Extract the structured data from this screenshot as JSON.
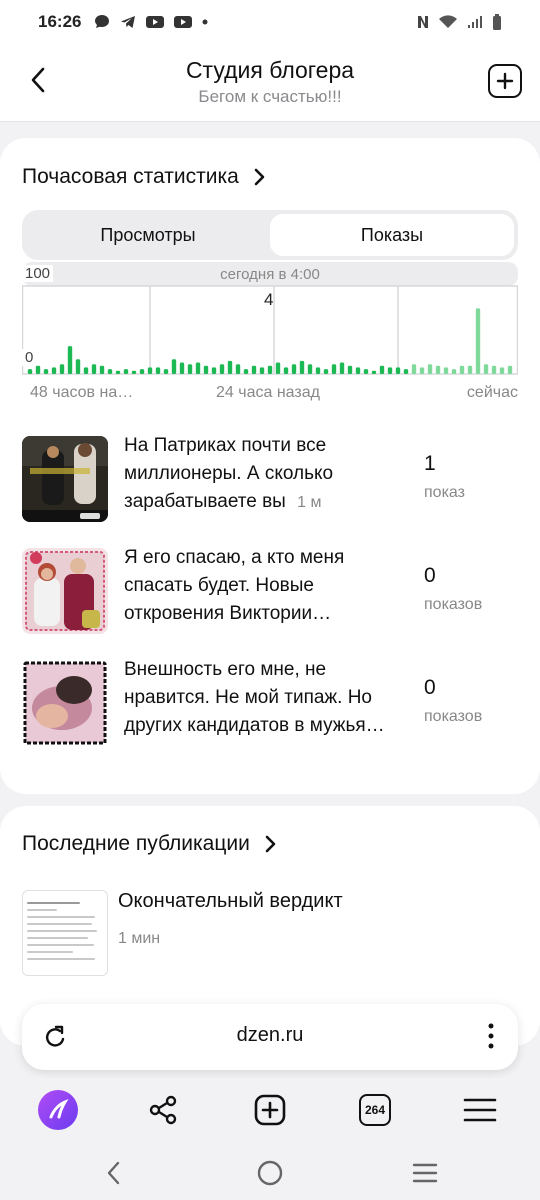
{
  "status_bar": {
    "time": "16:26"
  },
  "header": {
    "title": "Студия блогера",
    "subtitle": "Бегом к счастью!!!"
  },
  "hourly": {
    "title": "Почасовая статистика",
    "tabs": [
      {
        "label": "Просмотры",
        "active": false
      },
      {
        "label": "Показы",
        "active": true
      }
    ]
  },
  "chart_data": {
    "type": "bar",
    "y_max_label": "100",
    "y_min_label": "0",
    "annotation": "сегодня в 4:00",
    "peak_label": "4",
    "x_labels": [
      "48 часов на…",
      "24 часа назад",
      "сейчас"
    ],
    "values": [
      0.3,
      0.5,
      0.3,
      0.4,
      0.6,
      1.7,
      0.9,
      0.4,
      0.6,
      0.5,
      0.3,
      0.2,
      0.3,
      0.2,
      0.3,
      0.4,
      0.4,
      0.3,
      0.9,
      0.7,
      0.6,
      0.7,
      0.5,
      0.4,
      0.6,
      0.8,
      0.6,
      0.3,
      0.5,
      0.4,
      0.5,
      0.7,
      0.4,
      0.6,
      0.8,
      0.6,
      0.4,
      0.3,
      0.6,
      0.7,
      0.5,
      0.4,
      0.3,
      0.2,
      0.5,
      0.4,
      0.4,
      0.3,
      0.6,
      0.4,
      0.6,
      0.5,
      0.4,
      0.3,
      0.5,
      0.5,
      4,
      0.6,
      0.5,
      0.4,
      0.5
    ],
    "highlight_from_index": 48,
    "colors": {
      "past": "#1db954",
      "recent": "#7ed99a"
    }
  },
  "stats_items": [
    {
      "title": "На Патриках почти все миллионеры. А сколько зарабатываете вы",
      "age": "1 м",
      "count": "1",
      "unit": "показ"
    },
    {
      "title": "Я его спасаю, а кто меня спасать будет. Новые откровения Виктории…",
      "age": "",
      "count": "0",
      "unit": "показов"
    },
    {
      "title": "Внешность его мне, не нравится. Не мой типаж. Но других кандидатов в мужья…",
      "age": "",
      "count": "0",
      "unit": "показов"
    }
  ],
  "publications": {
    "title": "Последние публикации",
    "items": [
      {
        "title": "Окончательный вердикт",
        "time": "1 мин"
      }
    ]
  },
  "browser": {
    "url": "dzen.ru",
    "tabs_count": "264"
  }
}
